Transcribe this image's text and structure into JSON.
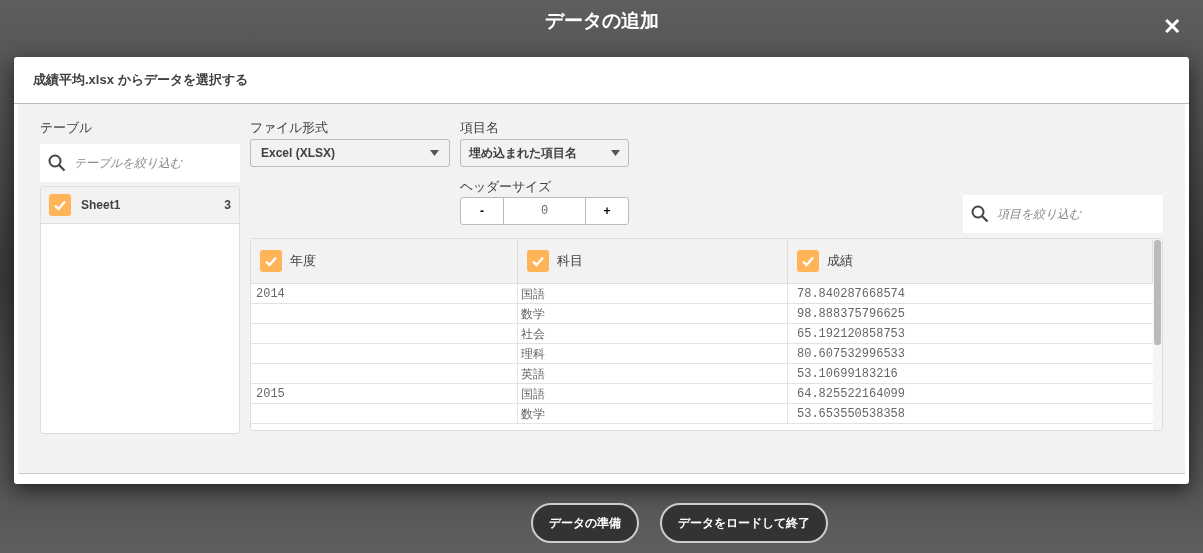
{
  "window": {
    "title": "データの追加",
    "close": "✕"
  },
  "dialog": {
    "title": "成績平均.xlsx からデータを選択する"
  },
  "tables_panel": {
    "label": "テーブル",
    "search": {
      "placeholder": "テーブルを絞り込む"
    },
    "items": [
      {
        "name": "Sheet1",
        "count": "3",
        "checked": true
      }
    ]
  },
  "file_format": {
    "label": "ファイル形式",
    "value": "Excel (XLSX)"
  },
  "field_names": {
    "label": "項目名",
    "value": "埋め込まれた項目名"
  },
  "header_size": {
    "label": "ヘッダーサイズ",
    "minus": "-",
    "value": "0",
    "plus": "+"
  },
  "field_search": {
    "placeholder": "項目を絞り込む"
  },
  "table": {
    "columns": [
      {
        "name": "年度",
        "checked": true
      },
      {
        "name": "科目",
        "checked": true
      },
      {
        "name": "成績",
        "checked": true
      }
    ],
    "rows": [
      {
        "year": "2014",
        "subject": "国語",
        "score": "78.840287668574"
      },
      {
        "subject": "数学",
        "score": "98.888375796625"
      },
      {
        "subject": "社会",
        "score": "65.192120858753"
      },
      {
        "subject": "理科",
        "score": "80.607532996533"
      },
      {
        "subject": "英語",
        "score": "53.10699183216"
      },
      {
        "year": "2015",
        "subject": "国語",
        "score": "64.825522164099"
      },
      {
        "subject": "数学",
        "score": "53.653550538358"
      }
    ]
  },
  "buttons": [
    {
      "label": "データの準備"
    },
    {
      "label": "データをロードして終了"
    }
  ]
}
